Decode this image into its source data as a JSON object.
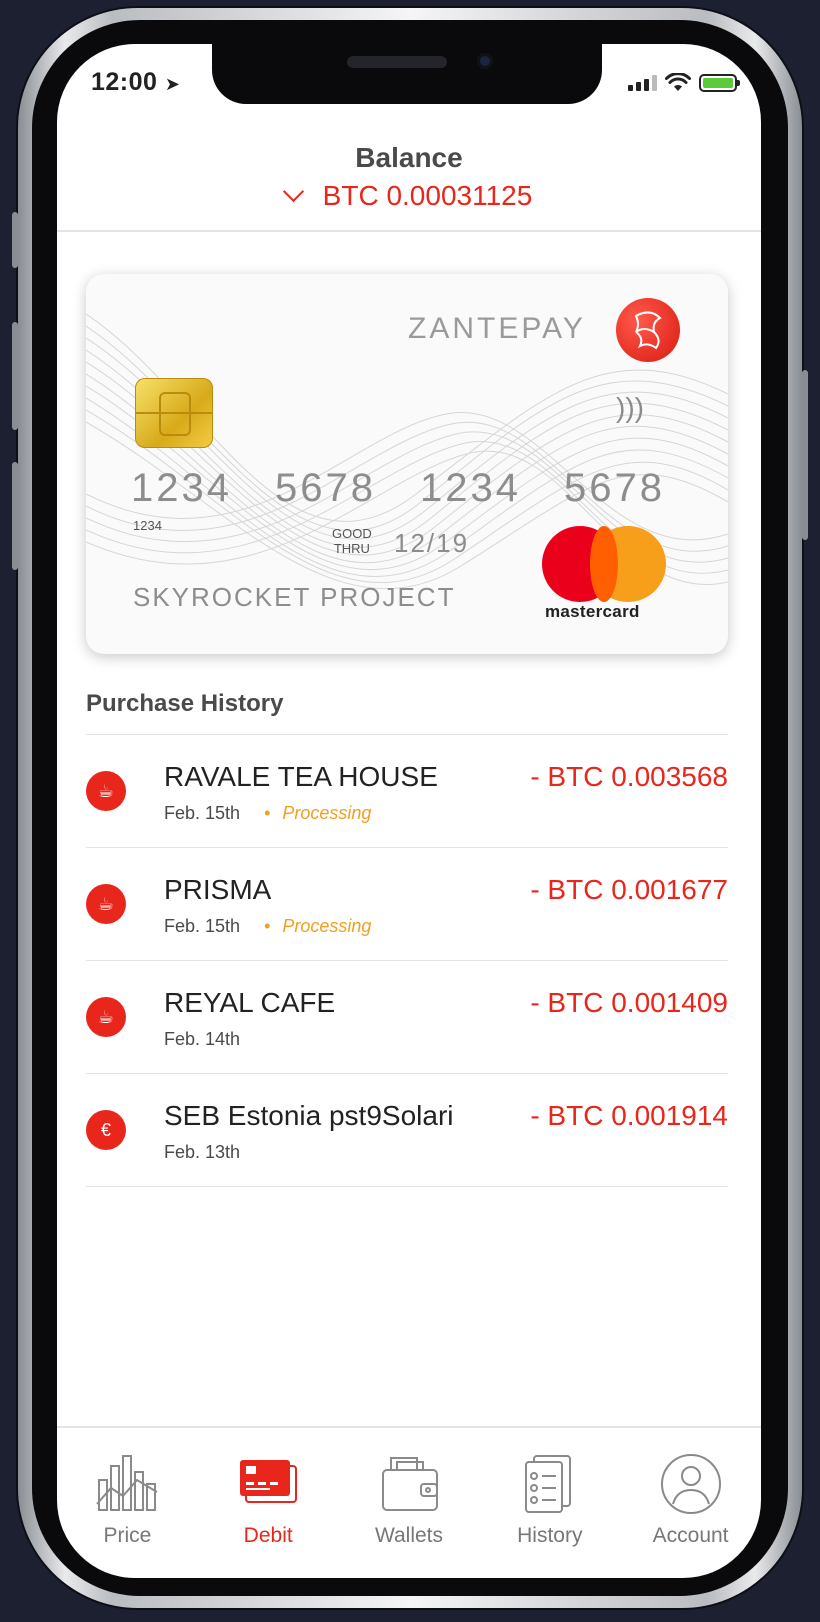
{
  "status_bar": {
    "time": "12:00"
  },
  "balance": {
    "title": "Balance",
    "value": "BTC 0.00031125"
  },
  "card": {
    "brand": "ZANTEPAY",
    "number_groups": [
      "1234",
      "5678",
      "1234",
      "5678"
    ],
    "small_number": "1234",
    "good_thru_label_1": "GOOD",
    "good_thru_label_2": "THRU",
    "expiry": "12/19",
    "holder": "SKYROCKET PROJECT",
    "network": "mastercard"
  },
  "purchase_history": {
    "title": "Purchase History",
    "items": [
      {
        "name": "RAVALE TEA HOUSE",
        "date": "Feb. 15th",
        "status": "Processing",
        "amount": "- BTC 0.003568",
        "icon": "tea-cup-icon"
      },
      {
        "name": "PRISMA",
        "date": "Feb. 15th",
        "status": "Processing",
        "amount": "- BTC 0.001677",
        "icon": "coffee-cup-icon"
      },
      {
        "name": "REYAL CAFE",
        "date": "Feb. 14th",
        "status": "",
        "amount": "- BTC 0.001409",
        "icon": "tea-cup-icon"
      },
      {
        "name": "SEB Estonia pst9Solari",
        "date": "Feb. 13th",
        "status": "",
        "amount": "- BTC 0.001914",
        "icon": "piggy-bank-icon"
      }
    ]
  },
  "tabs": [
    {
      "label": "Price",
      "icon": "price-chart-icon",
      "active": false
    },
    {
      "label": "Debit",
      "icon": "debit-card-icon",
      "active": true
    },
    {
      "label": "Wallets",
      "icon": "wallet-icon",
      "active": false
    },
    {
      "label": "History",
      "icon": "history-list-icon",
      "active": false
    },
    {
      "label": "Account",
      "icon": "account-user-icon",
      "active": false
    }
  ],
  "colors": {
    "accent": "#e8261b",
    "processing": "#f0a020",
    "text": "#222222",
    "muted": "#777777"
  }
}
